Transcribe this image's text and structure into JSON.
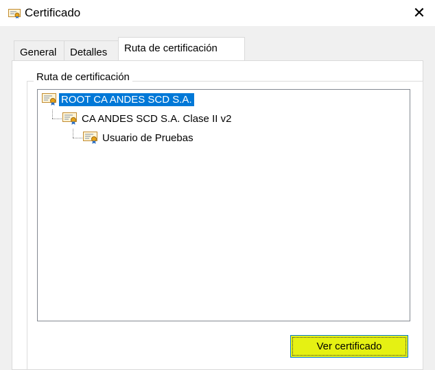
{
  "window": {
    "title": "Certificado",
    "close_glyph": "✕"
  },
  "tabs": [
    {
      "label": "General",
      "active": false
    },
    {
      "label": "Detalles",
      "active": false
    },
    {
      "label": "Ruta de certificación",
      "active": true
    }
  ],
  "group": {
    "label": "Ruta de certificación"
  },
  "tree": {
    "nodes": [
      {
        "label": "ROOT CA ANDES SCD S.A.",
        "level": 0,
        "selected": true,
        "icon": "certificate-icon"
      },
      {
        "label": "CA ANDES SCD S.A. Clase II v2",
        "level": 1,
        "selected": false,
        "icon": "certificate-icon"
      },
      {
        "label": "Usuario de Pruebas",
        "level": 2,
        "selected": false,
        "icon": "certificate-icon"
      }
    ]
  },
  "buttons": {
    "view_certificate": "Ver certificado"
  },
  "colors": {
    "selection": "#0078d7",
    "highlight": "#e5f113",
    "dialog_bg": "#f0f0f0"
  }
}
